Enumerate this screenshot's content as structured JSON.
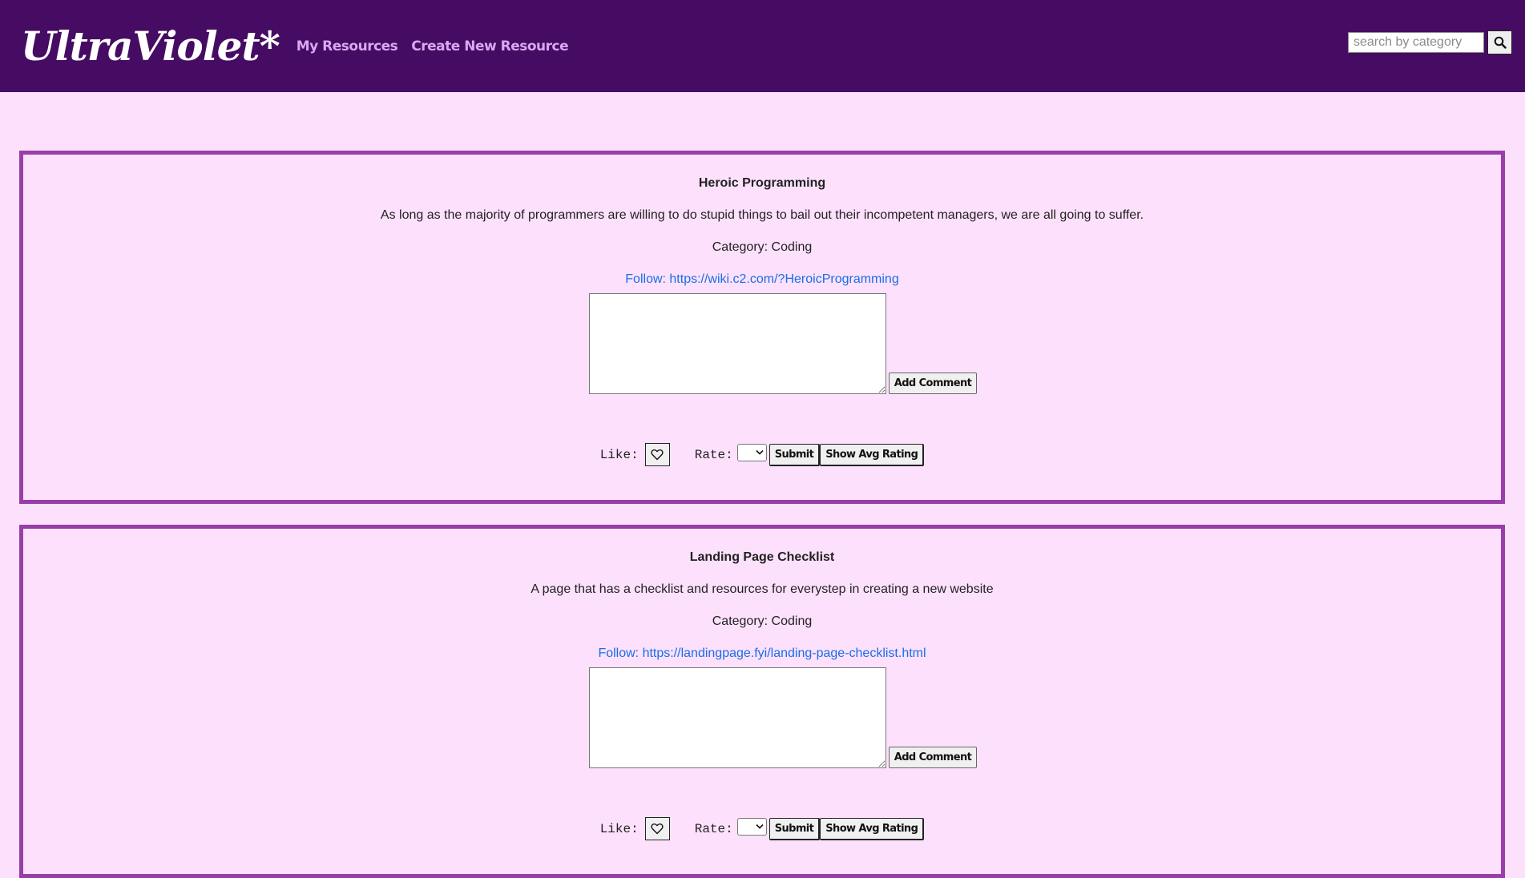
{
  "navbar": {
    "brand": "UltraViolet*",
    "links": [
      "My Resources",
      "Create New Resource"
    ],
    "search": {
      "placeholder": "search by category",
      "value": ""
    }
  },
  "resources": [
    {
      "title": "Heroic Programming",
      "description": "As long as the majority of programmers are willing to do stupid things to bail out their incompetent managers, we are all going to suffer.",
      "category": "Category: Coding",
      "link": "Follow: https://wiki.c2.com/?HeroicProgramming",
      "comment_value": "",
      "add_comment_label": "Add Comment",
      "like_label": "Like:",
      "rate_label": "Rate:",
      "rate_selected": "",
      "submit_label": "Submit",
      "avg_label": "Show Avg Rating"
    },
    {
      "title": "Landing Page Checklist",
      "description": "A page that has a checklist and resources for everystep in creating a new website",
      "category": "Category: Coding",
      "link": "Follow: https://landingpage.fyi/landing-page-checklist.html",
      "comment_value": "",
      "add_comment_label": "Add Comment",
      "like_label": "Like:",
      "rate_label": "Rate:",
      "rate_selected": "",
      "submit_label": "Submit",
      "avg_label": "Show Avg Rating"
    }
  ],
  "icons": {
    "search": "search-icon",
    "like": "heart-icon",
    "dropdown": "chevron-down-icon"
  },
  "colors": {
    "nav_bg": "#460c63",
    "page_bg": "#fde1fc",
    "card_border": "#973ea9",
    "link": "#1a6ee6",
    "nav_link": "#d9a8f2"
  }
}
